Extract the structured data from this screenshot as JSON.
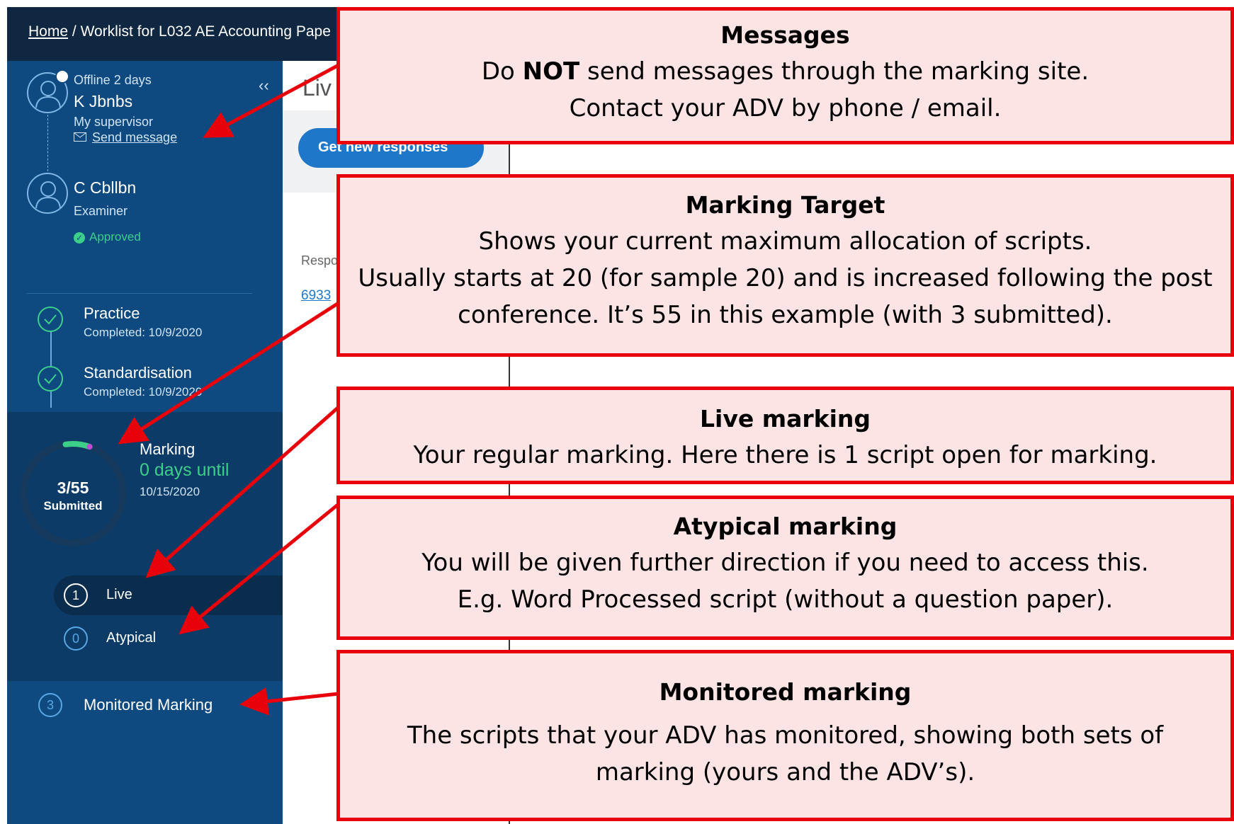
{
  "topbar": {
    "home_link": "Home",
    "separator": "/",
    "worklist_title": "Worklist for L032 AE Accounting Pape"
  },
  "sidebar": {
    "collapse_glyph": "‹‹",
    "supervisor": {
      "status": "Offline 2 days",
      "name": "K Jbnbs",
      "role": "My supervisor",
      "send_message": "Send message"
    },
    "examiner": {
      "name": "C Cbllbn",
      "role": "Examiner",
      "approval": "Approved"
    },
    "steps": [
      {
        "title": "Practice",
        "completed": "Completed:  10/9/2020"
      },
      {
        "title": "Standardisation",
        "completed": "Completed:  10/9/2020"
      }
    ],
    "marking": {
      "count": "3/55",
      "count_label": "Submitted",
      "title": "Marking",
      "days": "0 days until",
      "date": "10/15/2020",
      "progress_fraction": 0.0545
    },
    "queues": [
      {
        "number": "1",
        "label": "Live"
      },
      {
        "number": "0",
        "label": "Atypical"
      }
    ],
    "monitored": {
      "number": "3",
      "label": "Monitored Marking"
    }
  },
  "main": {
    "title_partial": "Liv",
    "get_button": "Get new responses",
    "response_header": "Respo",
    "response_link": "6933"
  },
  "callouts": {
    "messages": {
      "title": "Messages",
      "line1_a": "Do ",
      "line1_bold": "NOT",
      "line1_b": " send messages through the marking site.",
      "line2": "Contact your ADV by phone / email."
    },
    "target": {
      "title": "Marking Target",
      "line1": "Shows your current maximum allocation of scripts.",
      "line2": "Usually starts at 20 (for sample 20) and is increased following the post",
      "line3": "conference.  It’s 55 in this example (with 3 submitted)."
    },
    "live": {
      "title": "Live marking",
      "line1": "Your regular marking.  Here there is 1 script open for marking."
    },
    "atypical": {
      "title": "Atypical marking",
      "line1": "You will be given further direction if you need to access this.",
      "line2": "E.g. Word Processed script (without a question paper)."
    },
    "monitored": {
      "title": "Monitored marking",
      "line1": "The scripts that your ADV has monitored, showing both sets of",
      "line2": "marking (yours and the ADV’s)."
    }
  },
  "colors": {
    "sidebar": "#0e4a7f",
    "topbar": "#0f2740",
    "accent_green": "#3ccf8a",
    "callout_border": "#e8000b",
    "callout_fill": "#fde4e4",
    "button_blue": "#1f77c9"
  }
}
